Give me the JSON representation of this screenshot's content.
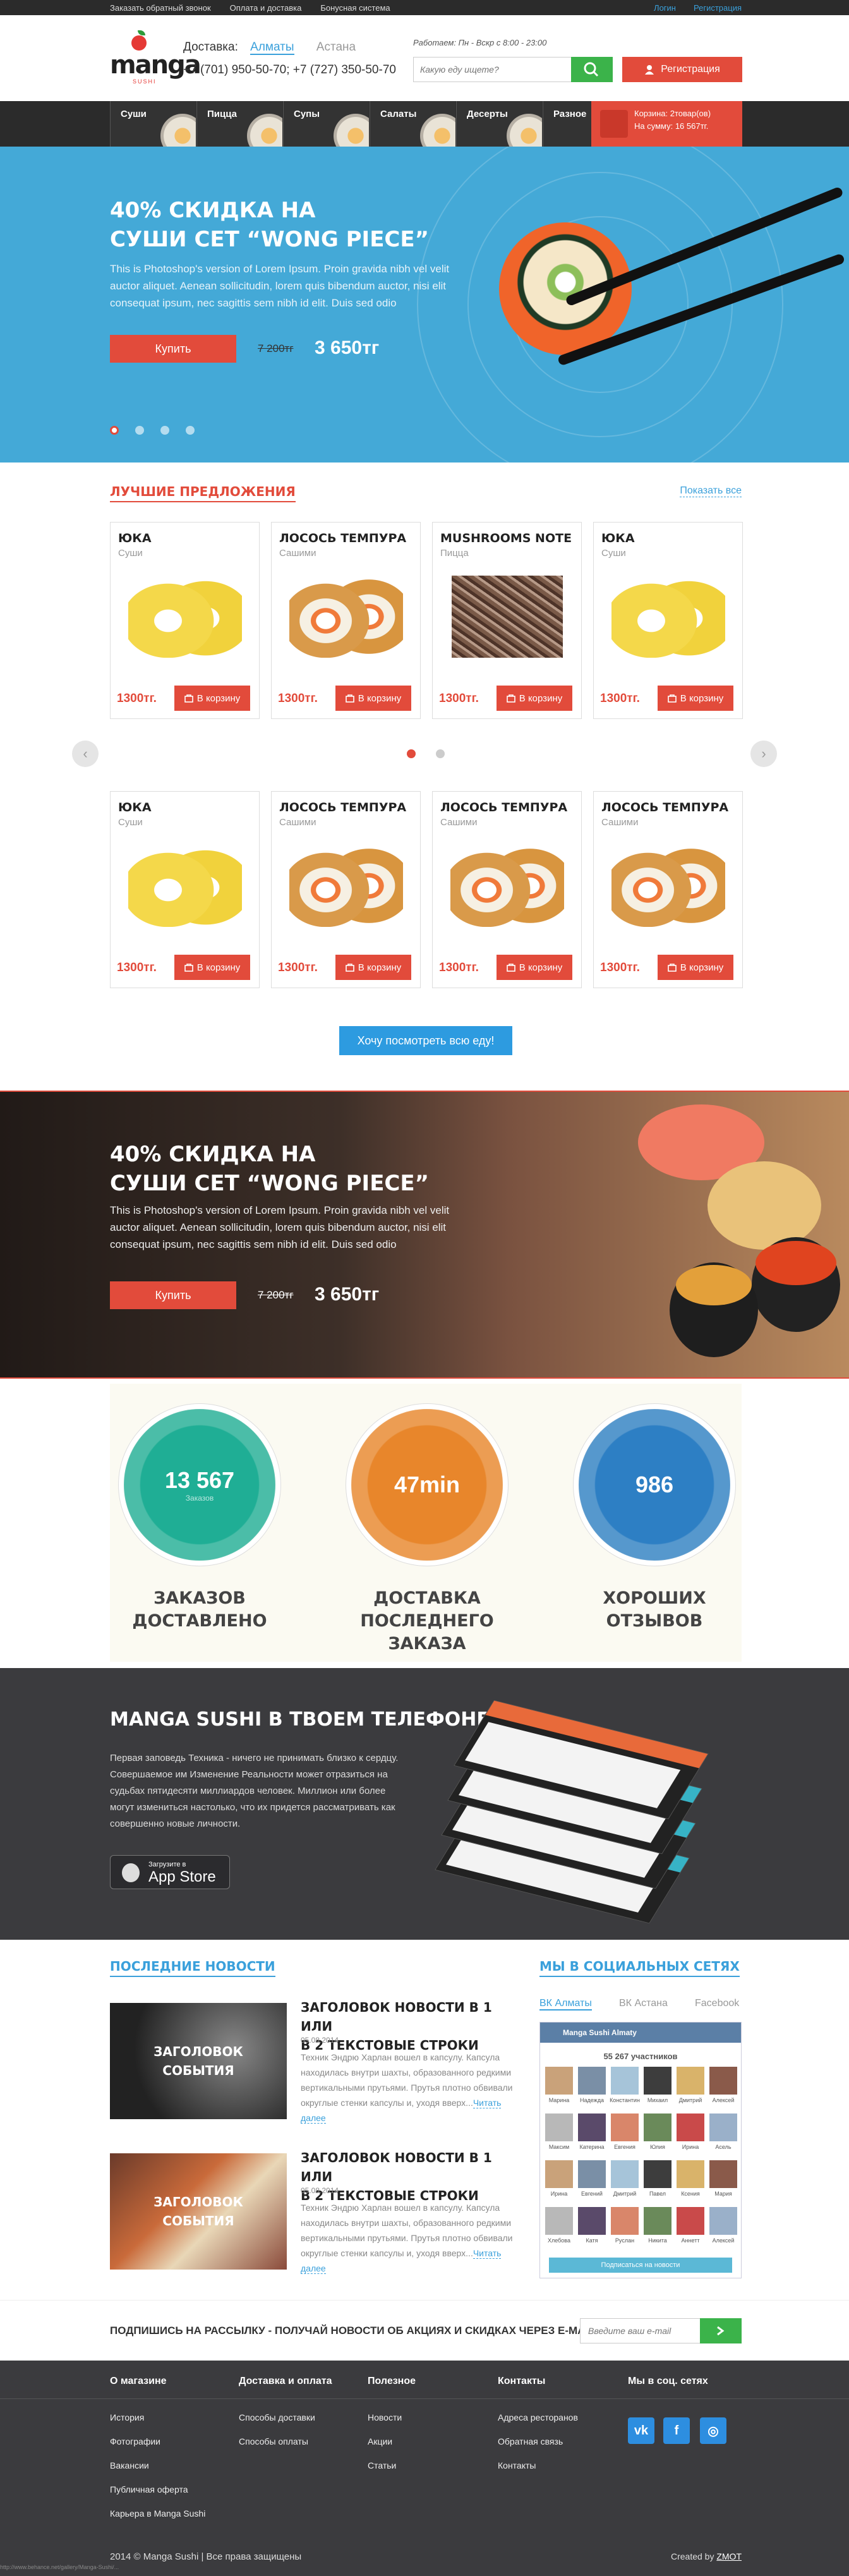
{
  "topbar": {
    "links": [
      "Заказать обратный звонок",
      "Оплата и доставка",
      "Бонусная система"
    ],
    "login": "Логин",
    "register": "Регистрация"
  },
  "header": {
    "logo_word": "manga",
    "logo_sub": "SUSHI",
    "delivery_label": "Доставка:",
    "city_active": "Алматы",
    "city_other": "Астана",
    "phones": "+7 (701) 950-50-70; +7 (727) 350-50-70",
    "hours": "Работаем: Пн - Вскр с 8:00 - 23:00",
    "search_placeholder": "Какую еду ищете?",
    "register_button": "Регистрация"
  },
  "menu": {
    "items": [
      "Суши",
      "Пицца",
      "Супы",
      "Салаты",
      "Десерты",
      "Разное"
    ],
    "cart_line1": "Корзина: 2товар(ов)",
    "cart_line2": "На сумму: 16 567тг."
  },
  "hero": {
    "title1": "40% СКИДКА НА",
    "title2": "СУШИ СЕТ “WONG PIECE”",
    "text": "This is Photoshop's version of Lorem Ipsum. Proin gravida nibh vel velit auctor aliquet. Aenean sollicitudin, lorem quis bibendum auctor, nisi elit consequat ipsum, nec sagittis sem nibh id elit. Duis sed odio",
    "buy": "Купить",
    "old_price": "7 200тг",
    "new_price": "3 650тг",
    "slides": 4,
    "active_slide": 1
  },
  "best": {
    "title": "ЛУЧШИЕ ПРЕДЛОЖЕНИЯ",
    "show_all": "Показать все",
    "add_label": "В корзину",
    "row1": [
      {
        "name": "ЮКА",
        "cat": "Суши",
        "price": "1300тг.",
        "img": "yellow"
      },
      {
        "name": "ЛОСОСЬ ТЕМПУРА",
        "cat": "Сашими",
        "price": "1300тг.",
        "img": "salmon"
      },
      {
        "name": "MUSHROOMS NOTE",
        "cat": "Пицца",
        "price": "1300тг.",
        "img": "mush"
      },
      {
        "name": "ЮКА",
        "cat": "Суши",
        "price": "1300тг.",
        "img": "yellow"
      }
    ],
    "row2": [
      {
        "name": "ЮКА",
        "cat": "Суши",
        "price": "1300тг.",
        "img": "yellow"
      },
      {
        "name": "ЛОСОСЬ ТЕМПУРА",
        "cat": "Сашими",
        "price": "1300тг.",
        "img": "salmon"
      },
      {
        "name": "ЛОСОСЬ ТЕМПУРА",
        "cat": "Сашими",
        "price": "1300тг.",
        "img": "salmon"
      },
      {
        "name": "ЛОСОСЬ ТЕМПУРА",
        "cat": "Сашими",
        "price": "1300тг.",
        "img": "salmon"
      }
    ],
    "see_all": "Хочу посмотреть всю еду!"
  },
  "hero2": {
    "title1": "40% СКИДКА НА",
    "title2": "СУШИ СЕТ “WONG PIECE”",
    "text": "This is Photoshop's version of Lorem Ipsum. Proin gravida nibh vel velit auctor aliquet. Aenean sollicitudin, lorem quis bibendum auctor, nisi elit consequat ipsum, nec sagittis sem nibh id elit. Duis sed odio",
    "buy": "Купить",
    "old_price": "7 200тг",
    "new_price": "3 650тг"
  },
  "stats": [
    {
      "value": "13 567",
      "sub": "Заказов",
      "caption1": "ЗАКАЗОВ",
      "caption2": "ДОСТАВЛЕНО",
      "color": "#1fae95"
    },
    {
      "value": "47min",
      "sub": "",
      "caption1": "ДОСТАВКА",
      "caption2": "ПОСЛЕДНЕГО ЗАКАЗА",
      "color": "#e8862b"
    },
    {
      "value": "986",
      "sub": "",
      "caption1": "ХОРОШИХ",
      "caption2": "ОТЗЫВОВ",
      "color": "#2d7fc4"
    }
  ],
  "app": {
    "title": "MANGA SUSHI В ТВОЕМ ТЕЛЕФОНЕ!",
    "text": "Первая заповедь Техника - ничего не принимать близко к сердцу. Совершаемое им Изменение Реальности может отразиться на судьбах пятидесяти миллиардов человек. Миллион или более могут измениться настолько, что их придется рассматривать как совершенно новые личности.",
    "store_small": "Загрузите в",
    "store_big": "App Store"
  },
  "news": {
    "title": "ПОСЛЕДНИЕ НОВОСТИ",
    "items": [
      {
        "img_text1": "ЗАГОЛОВОК",
        "img_text2": "СОБЫТИЯ",
        "title1": "ЗАГОЛОВОК НОВОСТИ В 1 ИЛИ",
        "title2": "В 2 ТЕКСТОВЫЕ СТРОКИ",
        "date": "05.08.2014",
        "text": "Техник Эндрю Харлан вошел в капсулу. Капсула находилась внутри шахты, образованного редкими вертикальными прутьями. Прутья плотно обвивали округлые стенки капсулы и, уходя вверх...",
        "more": "Читать далее"
      },
      {
        "img_text1": "ЗАГОЛОВОК",
        "img_text2": "СОБЫТИЯ",
        "title1": "ЗАГОЛОВОК НОВОСТИ В 1 ИЛИ",
        "title2": "В 2 ТЕКСТОВЫЕ СТРОКИ",
        "date": "05.08.2014",
        "text": "Техник Эндрю Харлан вошел в капсулу. Капсула находилась внутри шахты, образованного редкими вертикальными прутьями. Прутья плотно обвивали округлые стенки капсулы и, уходя вверх...",
        "more": "Читать далее"
      }
    ]
  },
  "social": {
    "title": "МЫ В СОЦИАЛЬНЫХ СЕТЯХ",
    "tabs": [
      "ВК Алматы",
      "ВК Астана",
      "Facebook"
    ],
    "group": "Manga Sushi Almaty",
    "members": "55 267 участников",
    "names": [
      "Марина",
      "Надежда",
      "Константин",
      "Михаил",
      "Дмитрий",
      "Алексей",
      "Максим",
      "Катерина",
      "Евгения",
      "Юлия",
      "Ирина",
      "Асель",
      "Ирина",
      "Евгений",
      "Дмитрий",
      "Павел",
      "Ксения",
      "Мария",
      "Хлебова",
      "Катя",
      "Руслан",
      "Никита",
      "Аннетт",
      "Алексей"
    ],
    "subscribe": "Подписаться на новости"
  },
  "subscribe": {
    "text": "ПОДПИШИСЬ НА РАССЫЛКУ - ПОЛУЧАЙ НОВОСТИ ОБ АКЦИЯХ И СКИДКАХ ЧЕРЕЗ E-MAIL!",
    "placeholder": "Введите ваш e-mail"
  },
  "footer": {
    "cols": [
      {
        "h": "О магазине",
        "items": [
          "История",
          "Фотографии",
          "Вакансии",
          "Публичная оферта",
          "Карьера в Manga Sushi"
        ]
      },
      {
        "h": "Доставка и оплата",
        "items": [
          "Способы доставки",
          "Способы оплаты"
        ]
      },
      {
        "h": "Полезное",
        "items": [
          "Новости",
          "Акции",
          "Статьи"
        ]
      },
      {
        "h": "Контакты",
        "items": [
          "Адреса ресторанов",
          "Обратная связь",
          "Контакты"
        ]
      },
      {
        "h": "Мы в соц. сетях",
        "items": []
      }
    ],
    "social_icons": [
      "vk",
      "f",
      "ig"
    ],
    "copyright": "2014 © Manga Sushi | Все права защищены",
    "created": "Created by",
    "author": "ZMOT",
    "url": "http://www.behance.net/gallery/Manga-Sushi/..."
  }
}
